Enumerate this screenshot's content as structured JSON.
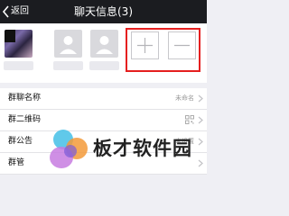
{
  "navbar": {
    "back_label": "返回",
    "title": "聊天信息(3)"
  },
  "members": {
    "names": [
      "",
      "",
      ""
    ],
    "add_icon": "plus-icon",
    "remove_icon": "minus-icon",
    "highlight_color": "#e51f1f"
  },
  "settings": {
    "rows": [
      {
        "label": "群聊名称",
        "value": "未命名"
      },
      {
        "label": "群二维码",
        "value": ""
      },
      {
        "label": "群公告",
        "value": "未设置"
      },
      {
        "label": "群管",
        "value": ""
      }
    ]
  },
  "watermark": {
    "text": "板才软件园"
  },
  "colors": {
    "navbar": "#1b1c20",
    "background": "#efeff4"
  }
}
